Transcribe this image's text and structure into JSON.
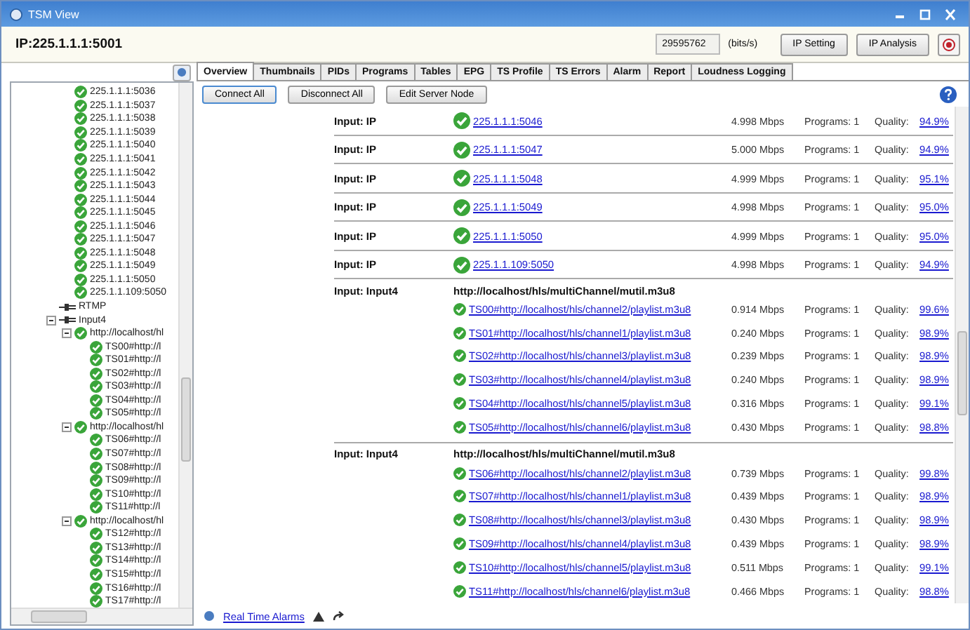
{
  "window": {
    "title": "TSM View"
  },
  "header": {
    "address": "IP:225.1.1.1:5001",
    "bitrate": "29595762",
    "bitrate_unit": "(bits/s)",
    "buttons": [
      "IP Setting",
      "IP Analysis"
    ]
  },
  "tabs": [
    {
      "label": "Overview",
      "selected": true
    },
    {
      "label": "Thumbnails",
      "selected": false
    },
    {
      "label": "PIDs",
      "selected": false
    },
    {
      "label": "Programs",
      "selected": false
    },
    {
      "label": "Tables",
      "selected": false
    },
    {
      "label": "EPG",
      "selected": false
    },
    {
      "label": "TS Profile",
      "selected": false
    },
    {
      "label": "TS Errors",
      "selected": false
    },
    {
      "label": "Alarm",
      "selected": false
    },
    {
      "label": "Report",
      "selected": false
    },
    {
      "label": "Loudness Logging",
      "selected": false
    }
  ],
  "tree": {
    "scrolled_items": [
      {
        "label": "225.1.1.1:5036"
      },
      {
        "label": "225.1.1.1:5037"
      },
      {
        "label": "225.1.1.1:5038"
      },
      {
        "label": "225.1.1.1:5039"
      },
      {
        "label": "225.1.1.1:5040"
      },
      {
        "label": "225.1.1.1:5041"
      },
      {
        "label": "225.1.1.1:5042"
      },
      {
        "label": "225.1.1.1:5043"
      },
      {
        "label": "225.1.1.1:5044"
      },
      {
        "label": "225.1.1.1:5045"
      },
      {
        "label": "225.1.1.1:5046"
      },
      {
        "label": "225.1.1.1:5047"
      },
      {
        "label": "225.1.1.1:5048"
      },
      {
        "label": "225.1.1.1:5049"
      },
      {
        "label": "225.1.1.1:5050"
      },
      {
        "label": "225.1.1.109:5050"
      }
    ],
    "nodes": [
      {
        "label": "RTMP",
        "kind": "input"
      },
      {
        "label": "Input4",
        "kind": "input",
        "expanded": true,
        "children": [
          {
            "label": "http://localhost/hl",
            "kind": "stream",
            "expanded": true,
            "children": [
              {
                "label": "TS00#http://l",
                "kind": "stream"
              },
              {
                "label": "TS01#http://l",
                "kind": "stream"
              },
              {
                "label": "TS02#http://l",
                "kind": "stream"
              },
              {
                "label": "TS03#http://l",
                "kind": "stream"
              },
              {
                "label": "TS04#http://l",
                "kind": "stream"
              },
              {
                "label": "TS05#http://l",
                "kind": "stream"
              }
            ]
          },
          {
            "label": "http://localhost/hl",
            "kind": "stream",
            "expanded": true,
            "children": [
              {
                "label": "TS06#http://l",
                "kind": "stream"
              },
              {
                "label": "TS07#http://l",
                "kind": "stream"
              },
              {
                "label": "TS08#http://l",
                "kind": "stream"
              },
              {
                "label": "TS09#http://l",
                "kind": "stream"
              },
              {
                "label": "TS10#http://l",
                "kind": "stream"
              },
              {
                "label": "TS11#http://l",
                "kind": "stream"
              }
            ]
          },
          {
            "label": "http://localhost/hl",
            "kind": "stream",
            "expanded": true,
            "children": [
              {
                "label": "TS12#http://l",
                "kind": "stream"
              },
              {
                "label": "TS13#http://l",
                "kind": "stream"
              },
              {
                "label": "TS14#http://l",
                "kind": "stream"
              },
              {
                "label": "TS15#http://l",
                "kind": "stream"
              },
              {
                "label": "TS16#http://l",
                "kind": "stream"
              },
              {
                "label": "TS17#http://l",
                "kind": "stream"
              }
            ]
          }
        ]
      }
    ]
  },
  "toolbar": [
    "Connect All",
    "Disconnect All",
    "Edit Server Node"
  ],
  "groups": [
    {
      "kind": "ip",
      "input": "Input: IP",
      "streams": [
        {
          "name": "225.1.1.1:5046",
          "rate": "4.998 Mbps",
          "programs": "Programs: 1",
          "quality_label": "Quality:",
          "quality": "94.9%"
        }
      ]
    },
    {
      "kind": "ip",
      "input": "Input: IP",
      "streams": [
        {
          "name": "225.1.1.1:5047",
          "rate": "5.000 Mbps",
          "programs": "Programs: 1",
          "quality_label": "Quality:",
          "quality": "94.9%"
        }
      ]
    },
    {
      "kind": "ip",
      "input": "Input: IP",
      "streams": [
        {
          "name": "225.1.1.1:5048",
          "rate": "4.999 Mbps",
          "programs": "Programs: 1",
          "quality_label": "Quality:",
          "quality": "95.1%"
        }
      ]
    },
    {
      "kind": "ip",
      "input": "Input: IP",
      "streams": [
        {
          "name": "225.1.1.1:5049",
          "rate": "4.998 Mbps",
          "programs": "Programs: 1",
          "quality_label": "Quality:",
          "quality": "95.0%"
        }
      ]
    },
    {
      "kind": "ip",
      "input": "Input: IP",
      "streams": [
        {
          "name": "225.1.1.1:5050",
          "rate": "4.999 Mbps",
          "programs": "Programs: 1",
          "quality_label": "Quality:",
          "quality": "95.0%"
        }
      ]
    },
    {
      "kind": "ip",
      "input": "Input: IP",
      "streams": [
        {
          "name": "225.1.1.109:5050",
          "rate": "4.998 Mbps",
          "programs": "Programs: 1",
          "quality_label": "Quality:",
          "quality": "94.9%"
        }
      ]
    },
    {
      "kind": "playlist",
      "input": "Input: Input4",
      "source": "http://localhost/hls/multiChannel/mutil.m3u8",
      "streams": [
        {
          "name": "TS00#http://localhost/hls/channel2/playlist.m3u8",
          "rate": "0.914 Mbps",
          "programs": "Programs: 1",
          "quality_label": "Quality:",
          "quality": "99.6%"
        },
        {
          "name": "TS01#http://localhost/hls/channel1/playlist.m3u8",
          "rate": "0.240 Mbps",
          "programs": "Programs: 1",
          "quality_label": "Quality:",
          "quality": "98.9%"
        },
        {
          "name": "TS02#http://localhost/hls/channel3/playlist.m3u8",
          "rate": "0.239 Mbps",
          "programs": "Programs: 1",
          "quality_label": "Quality:",
          "quality": "98.9%"
        },
        {
          "name": "TS03#http://localhost/hls/channel4/playlist.m3u8",
          "rate": "0.240 Mbps",
          "programs": "Programs: 1",
          "quality_label": "Quality:",
          "quality": "98.9%"
        },
        {
          "name": "TS04#http://localhost/hls/channel5/playlist.m3u8",
          "rate": "0.316 Mbps",
          "programs": "Programs: 1",
          "quality_label": "Quality:",
          "quality": "99.1%"
        },
        {
          "name": "TS05#http://localhost/hls/channel6/playlist.m3u8",
          "rate": "0.430 Mbps",
          "programs": "Programs: 1",
          "quality_label": "Quality:",
          "quality": "98.8%"
        }
      ]
    },
    {
      "kind": "playlist",
      "input": "Input: Input4",
      "source": "http://localhost/hls/multiChannel/mutil.m3u8",
      "streams": [
        {
          "name": "TS06#http://localhost/hls/channel2/playlist.m3u8",
          "rate": "0.739 Mbps",
          "programs": "Programs: 1",
          "quality_label": "Quality:",
          "quality": "99.8%"
        },
        {
          "name": "TS07#http://localhost/hls/channel1/playlist.m3u8",
          "rate": "0.439 Mbps",
          "programs": "Programs: 1",
          "quality_label": "Quality:",
          "quality": "98.9%"
        },
        {
          "name": "TS08#http://localhost/hls/channel3/playlist.m3u8",
          "rate": "0.430 Mbps",
          "programs": "Programs: 1",
          "quality_label": "Quality:",
          "quality": "98.9%"
        },
        {
          "name": "TS09#http://localhost/hls/channel4/playlist.m3u8",
          "rate": "0.439 Mbps",
          "programs": "Programs: 1",
          "quality_label": "Quality:",
          "quality": "98.9%"
        },
        {
          "name": "TS10#http://localhost/hls/channel5/playlist.m3u8",
          "rate": "0.511 Mbps",
          "programs": "Programs: 1",
          "quality_label": "Quality:",
          "quality": "99.1%"
        },
        {
          "name": "TS11#http://localhost/hls/channel6/playlist.m3u8",
          "rate": "0.466 Mbps",
          "programs": "Programs: 1",
          "quality_label": "Quality:",
          "quality": "98.8%"
        }
      ]
    }
  ],
  "footer": {
    "alarms_link": "Real Time Alarms"
  }
}
